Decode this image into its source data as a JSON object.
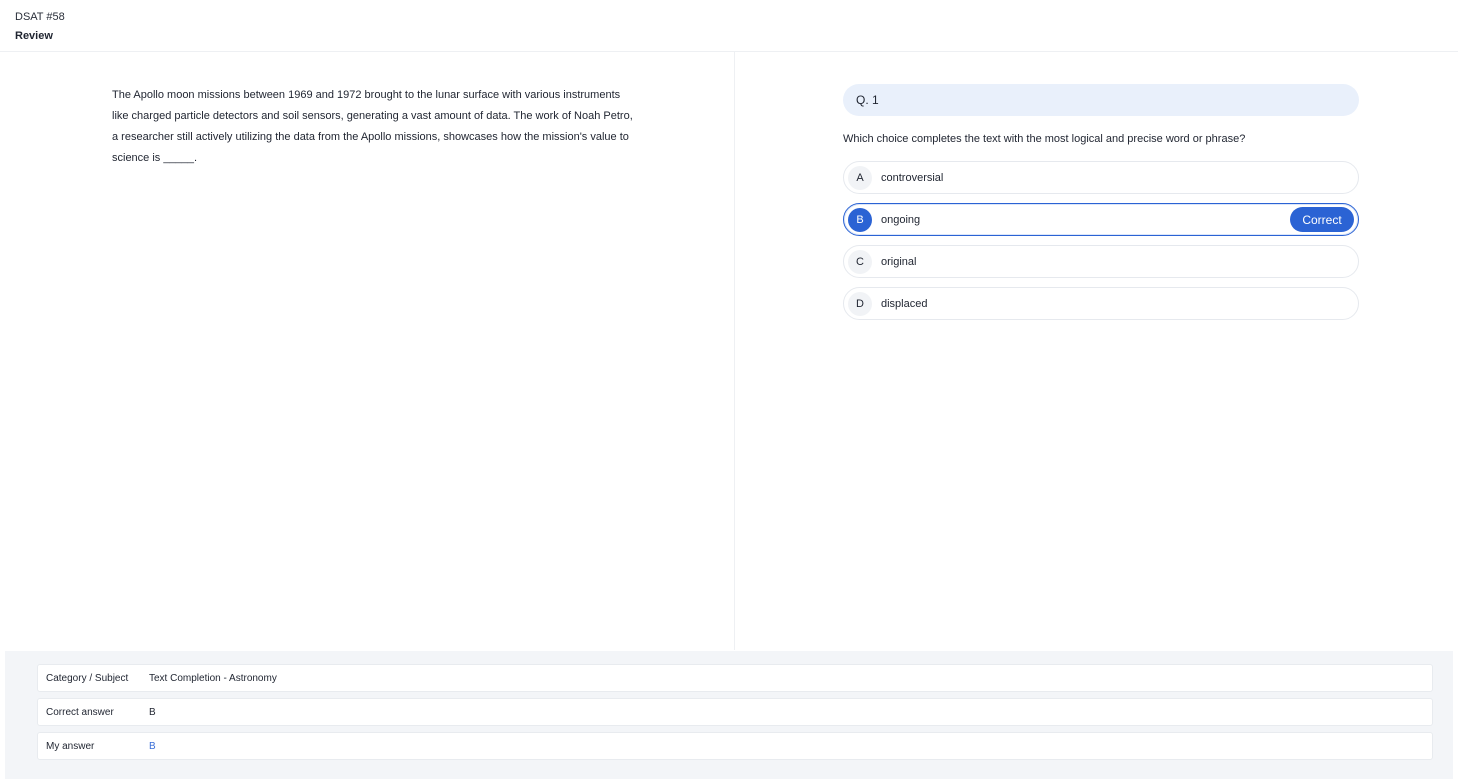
{
  "header": {
    "exam_label": "DSAT #58",
    "title": "Review"
  },
  "passage": {
    "text": "The Apollo moon missions between 1969 and 1972 brought to the lunar surface with various instruments like charged particle detectors and soil sensors, generating a vast amount of data. The work of Noah Petro, a researcher still actively utilizing the data from the Apollo missions, showcases how the mission's value to science is _____."
  },
  "question": {
    "number_label": "Q. 1",
    "prompt": "Which choice completes the text with the most logical and precise word or phrase?",
    "choices": [
      {
        "letter": "A",
        "text": "controversial"
      },
      {
        "letter": "B",
        "text": "ongoing"
      },
      {
        "letter": "C",
        "text": "original"
      },
      {
        "letter": "D",
        "text": "displaced"
      }
    ],
    "selected": "B",
    "correct_badge": "Correct"
  },
  "info": {
    "category_label": "Category / Subject",
    "category_value": "Text Completion - Astronomy",
    "correct_answer_label": "Correct answer",
    "correct_answer_value": "B",
    "my_answer_label": "My answer",
    "my_answer_value": "B"
  },
  "colors": {
    "accent": "#2b63d4",
    "question_header_bg": "#e9f0fb",
    "footer_bg": "#f3f5f8",
    "my_answer": "#3b6fd8"
  }
}
